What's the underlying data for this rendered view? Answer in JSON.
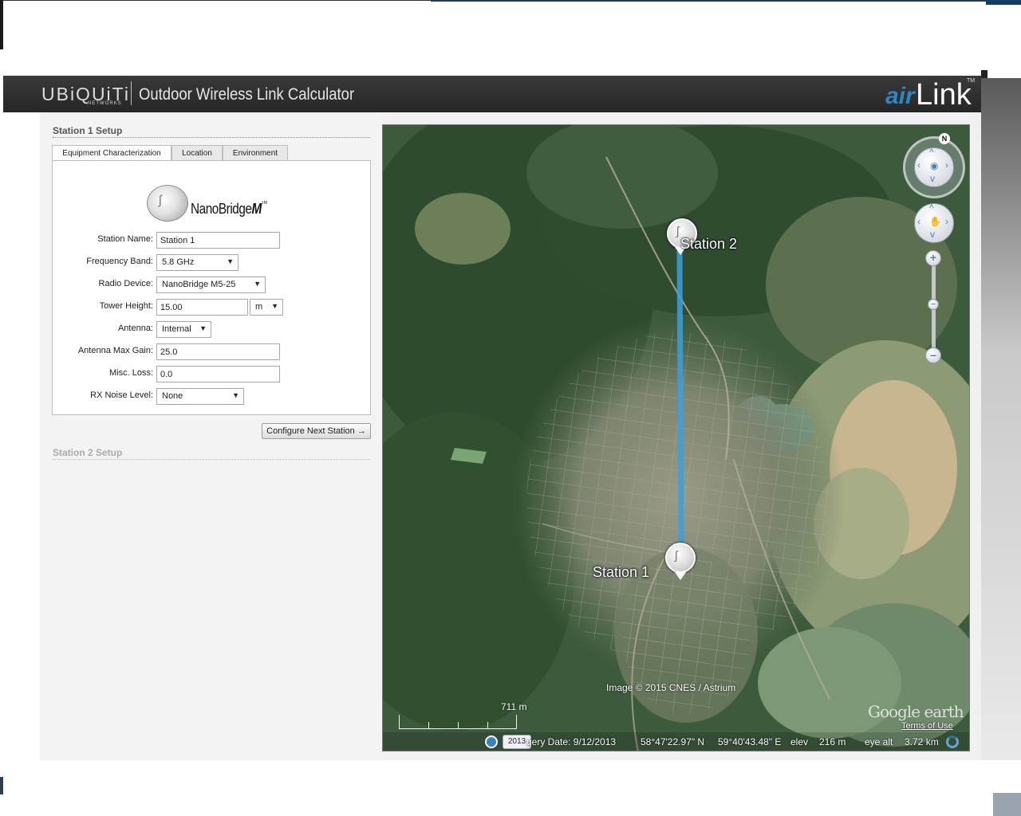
{
  "header": {
    "brand_logo": "UBiQUiTi",
    "brand_sub": "NETWORKS",
    "title": "Outdoor Wireless Link Calculator",
    "airlink_air": "air",
    "airlink_link": "Link",
    "airlink_tm": "TM"
  },
  "station1": {
    "section_title": "Station 1 Setup",
    "tabs": [
      {
        "label": "Equipment Characterization",
        "active": true
      },
      {
        "label": "Location",
        "active": false
      },
      {
        "label": "Environment",
        "active": false
      }
    ],
    "product": {
      "name": "NanoBridge",
      "suffix": "M",
      "tm": "TM"
    },
    "fields": {
      "station_name": {
        "label": "Station Name:",
        "value": "Station 1"
      },
      "frequency_band": {
        "label": "Frequency Band:",
        "value": "5.8 GHz"
      },
      "radio_device": {
        "label": "Radio Device:",
        "value": "NanoBridge M5-25"
      },
      "tower_height": {
        "label": "Tower Height:",
        "value": "15.00",
        "unit": "m"
      },
      "antenna": {
        "label": "Antenna:",
        "value": "Internal"
      },
      "antenna_max_gain": {
        "label": "Antenna Max Gain:",
        "value": "25.0"
      },
      "misc_loss": {
        "label": "Misc. Loss:",
        "value": "0.0"
      },
      "rx_noise_level": {
        "label": "RX Noise Level:",
        "value": "None"
      }
    },
    "next_button": "Configure Next Station →"
  },
  "station2": {
    "section_title": "Station 2 Setup"
  },
  "map": {
    "station1_label": "Station 1",
    "station2_label": "Station 2",
    "compass_n": "N",
    "credit": "Image © 2015 CNES / Astrium",
    "google_earth": "Google earth",
    "terms": "Terms of Use",
    "scale_label": "711 m",
    "year_chip": "2013",
    "imagery_date": "gery Date: 9/12/2013",
    "latitude": "58°47'22.97\" N",
    "longitude": "59°40'43.48\" E",
    "elev_label": "elev",
    "elev_value": "216 m",
    "eye_alt_label": "eye alt",
    "eye_alt_value": "3.72 km",
    "link_color": "#3aa0e0"
  }
}
